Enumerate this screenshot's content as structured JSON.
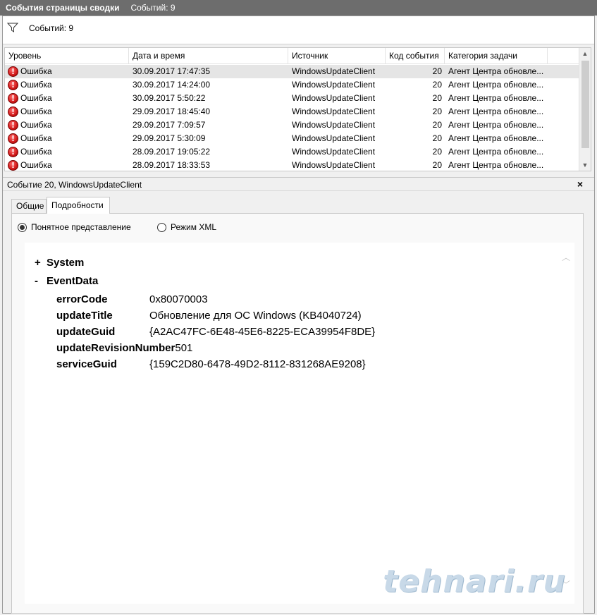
{
  "window": {
    "title": "События страницы сводки",
    "count_label": "Событий: 9"
  },
  "filter": {
    "icon": "filter-icon",
    "count_label": "Событий: 9"
  },
  "grid": {
    "columns": [
      "Уровень",
      "Дата и время",
      "Источник",
      "Код события",
      "Категория задачи"
    ],
    "rows": [
      {
        "level": "Ошибка",
        "datetime": "30.09.2017 17:47:35",
        "source": "WindowsUpdateClient",
        "code": "20",
        "category": "Агент Центра обновле..."
      },
      {
        "level": "Ошибка",
        "datetime": "30.09.2017 14:24:00",
        "source": "WindowsUpdateClient",
        "code": "20",
        "category": "Агент Центра обновле..."
      },
      {
        "level": "Ошибка",
        "datetime": "30.09.2017 5:50:22",
        "source": "WindowsUpdateClient",
        "code": "20",
        "category": "Агент Центра обновле..."
      },
      {
        "level": "Ошибка",
        "datetime": "29.09.2017 18:45:40",
        "source": "WindowsUpdateClient",
        "code": "20",
        "category": "Агент Центра обновле..."
      },
      {
        "level": "Ошибка",
        "datetime": "29.09.2017 7:09:57",
        "source": "WindowsUpdateClient",
        "code": "20",
        "category": "Агент Центра обновле..."
      },
      {
        "level": "Ошибка",
        "datetime": "29.09.2017 5:30:09",
        "source": "WindowsUpdateClient",
        "code": "20",
        "category": "Агент Центра обновле..."
      },
      {
        "level": "Ошибка",
        "datetime": "28.09.2017 19:05:22",
        "source": "WindowsUpdateClient",
        "code": "20",
        "category": "Агент Центра обновле..."
      },
      {
        "level": "Ошибка",
        "datetime": "28.09.2017 18:33:53",
        "source": "WindowsUpdateClient",
        "code": "20",
        "category": "Агент Центра обновле..."
      }
    ]
  },
  "details": {
    "title": "Событие 20, WindowsUpdateClient",
    "close_label": "×",
    "tabs": [
      "Общие",
      "Подробности"
    ],
    "view_modes": [
      "Понятное представление",
      "Режим XML"
    ],
    "tree": {
      "system": {
        "sign": "+",
        "label": "System"
      },
      "eventdata": {
        "sign": "-",
        "label": "EventData"
      }
    },
    "fields": [
      {
        "key": "errorCode",
        "value": "0x80070003"
      },
      {
        "key": "updateTitle",
        "value": "Обновление для ОС Windows (KB4040724)"
      },
      {
        "key": "updateGuid",
        "value": "{A2AC47FC-6E48-45E6-8225-ECA39954F8DE}"
      },
      {
        "key": "updateRevisionNumber",
        "value": "501"
      },
      {
        "key": "serviceGuid",
        "value": "{159C2D80-6478-49D2-8112-831268AE9208}"
      }
    ]
  },
  "watermark": "tehnari.ru"
}
